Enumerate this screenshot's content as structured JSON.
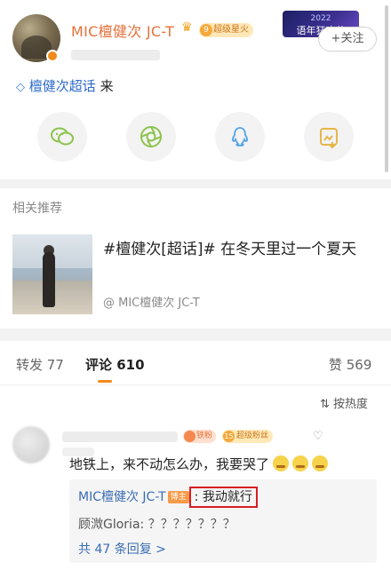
{
  "post": {
    "author": "MIC檀健次 JC-T",
    "level": "9",
    "level_label": "超级星火",
    "follow_label": "+关注",
    "ad": {
      "year": "2022",
      "text": "语年狂欢节"
    },
    "topic": "檀健次超话",
    "topic_action": "来"
  },
  "share": {
    "icons": [
      "wechat-icon",
      "moments-icon",
      "qq-icon",
      "save-image-icon"
    ]
  },
  "related": {
    "heading": "相关推荐",
    "card_title": "#檀健次[超话]# 在冬天里过一个夏天",
    "card_author": "@ MIC檀健次 JC-T"
  },
  "tabs": {
    "repost": "转发 77",
    "comment": "评论 610",
    "like": "赞 569"
  },
  "sort_label": "按热度",
  "comment": {
    "fan_badge": "铁粉",
    "level": "15",
    "level_label": "超级粉丝",
    "text": "地铁上，来不动怎么办，我要哭了",
    "replies": [
      {
        "author": "MIC檀健次 JC-T",
        "tag": "博主",
        "text": "我动就行"
      },
      {
        "author": "顾溦Gloria",
        "text": "？？？？？？？"
      }
    ],
    "more": "共 47 条回复 >"
  },
  "colors": {
    "accent": "#f28a1c",
    "username": "#e8703a",
    "link": "#3a6db5",
    "highlight_border": "#d81e22"
  }
}
